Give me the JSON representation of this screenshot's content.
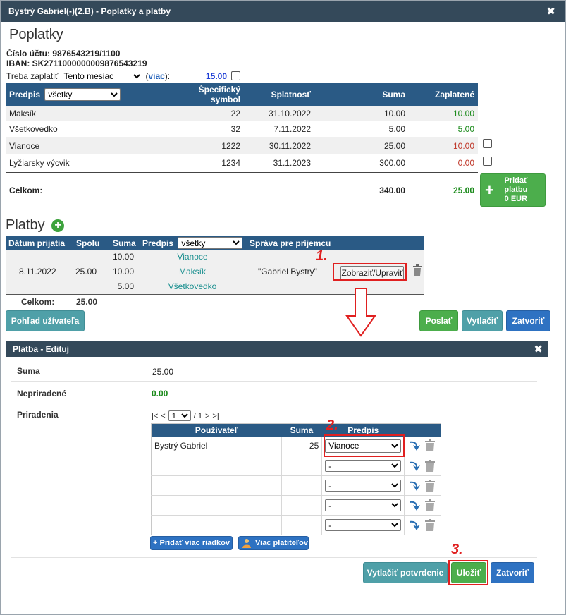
{
  "window": {
    "title": "Bystrý Gabriel(-)(2.B) - Poplatky a platby",
    "close": "✖"
  },
  "fees": {
    "heading": "Poplatky",
    "account_line": "Číslo účtu: 9876543219/1100",
    "iban_line": "IBAN: SK2711000000009876543219",
    "due_label": "Treba zaplatiť",
    "period_selected": "Tento mesiac",
    "more_link": "viac",
    "due_amount": "15.00",
    "table": {
      "headers": {
        "predpis": "Predpis",
        "filter": "všetky",
        "symbol_1": "Špecifický",
        "symbol_2": "symbol",
        "due_date": "Splatnosť",
        "sum": "Suma",
        "paid": "Zaplatené"
      },
      "rows": [
        {
          "name": "Maksík",
          "symbol": "22",
          "due": "31.10.2022",
          "sum": "10.00",
          "paid": "10.00",
          "status": "paid"
        },
        {
          "name": "Všetkovedko",
          "symbol": "32",
          "due": "7.11.2022",
          "sum": "5.00",
          "paid": "5.00",
          "status": "paid"
        },
        {
          "name": "Vianoce",
          "symbol": "1222",
          "due": "30.11.2022",
          "sum": "25.00",
          "paid": "10.00",
          "status": "partial"
        },
        {
          "name": "Lyžiarsky výcvik",
          "symbol": "1234",
          "due": "31.1.2023",
          "sum": "300.00",
          "paid": "0.00",
          "status": "unpaid"
        }
      ],
      "total_label": "Celkom:",
      "total_sum": "340.00",
      "total_paid": "25.00"
    },
    "add_payment_btn": {
      "plus": "+",
      "line1": "Pridať",
      "line2": "platbu",
      "line3": "0 EUR"
    }
  },
  "payments": {
    "heading": "Platby",
    "add_icon": "+",
    "headers": {
      "date": "Dátum prijatia",
      "total": "Spolu",
      "sum": "Suma",
      "predpis": "Predpis",
      "filter": "všetky",
      "message": "Správa pre príjemcu"
    },
    "row": {
      "date": "8.11.2022",
      "total": "25.00",
      "splits": [
        {
          "sum": "10.00",
          "predpis": "Vianoce"
        },
        {
          "sum": "10.00",
          "predpis": "Maksík"
        },
        {
          "sum": "5.00",
          "predpis": "Všetkovedko"
        }
      ],
      "message": "\"Gabriel Bystry\"",
      "action": "Zobraziť/Upraviť"
    },
    "total_label": "Celkom:",
    "total_value": "25.00"
  },
  "actions": {
    "user_view": "Pohľad užívateľa",
    "send": "Poslať",
    "print": "Vytlačiť",
    "close": "Zatvoriť"
  },
  "annotations": {
    "step1": "1.",
    "step2": "2.",
    "step3": "3."
  },
  "edit": {
    "title": "Platba - Edituj",
    "close": "✖",
    "sum_label": "Suma",
    "sum_value": "25.00",
    "unassigned_label": "Nepriradené",
    "unassigned_value": "0.00",
    "assignments_label": "Priradenia",
    "pager": {
      "first": "|<",
      "prev": "<",
      "page": "1",
      "of": "/ 1",
      "next": ">",
      "last": ">|"
    },
    "headers": {
      "user": "Používateľ",
      "sum": "Suma",
      "predpis": "Predpis"
    },
    "rows": [
      {
        "user": "Bystrý Gabriel",
        "sum": "25",
        "predpis": "Vianoce"
      },
      {
        "user": "",
        "sum": "",
        "predpis": "-"
      },
      {
        "user": "",
        "sum": "",
        "predpis": "-"
      },
      {
        "user": "",
        "sum": "",
        "predpis": "-"
      },
      {
        "user": "",
        "sum": "",
        "predpis": "-"
      }
    ],
    "add_rows": "+ Pridať viac riadkov",
    "more_payers": "Viac platiteľov",
    "print_confirmation": "Vytlačiť potvrdenie",
    "save": "Uložiť",
    "close_btn": "Zatvoriť"
  }
}
